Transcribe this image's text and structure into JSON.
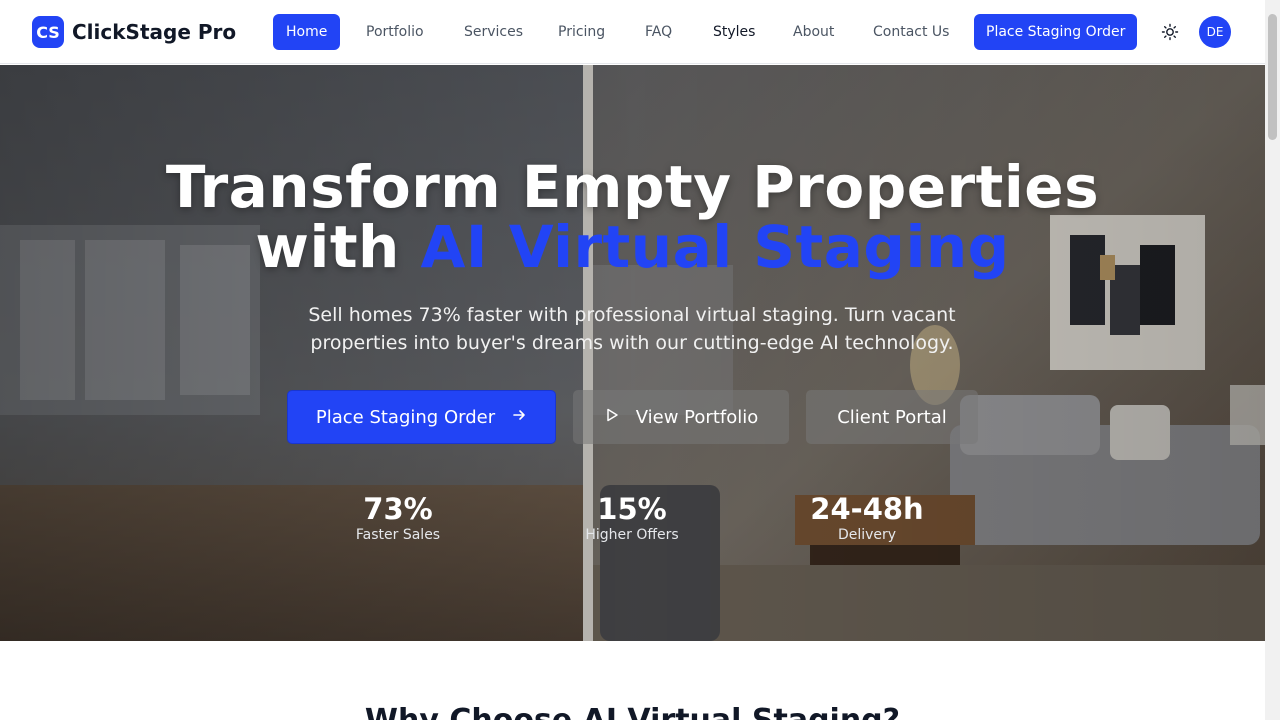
{
  "brand": {
    "logo_text": "CS",
    "name": "ClickStage Pro"
  },
  "nav": {
    "items": [
      {
        "label": "Home",
        "active": true
      },
      {
        "label": "Portfolio"
      },
      {
        "label": "Services"
      },
      {
        "label": "Pricing"
      },
      {
        "label": "FAQ"
      },
      {
        "label": "Styles"
      },
      {
        "label": "About"
      },
      {
        "label": "Contact Us"
      }
    ],
    "cta_label": "Place Staging Order",
    "theme_icon": "sun-icon",
    "avatar_initials": "DE"
  },
  "hero": {
    "title_line1": "Transform Empty Properties",
    "title_line2_prefix": "with",
    "title_line2_accent": "AI Virtual Staging",
    "subtitle": "Sell homes 73% faster with professional virtual staging. Turn vacant properties into buyer's dreams with our cutting-edge AI technology.",
    "buttons": {
      "primary": "Place Staging Order",
      "secondary": "View Portfolio",
      "tertiary": "Client Portal"
    },
    "stats": [
      {
        "value": "73%",
        "label": "Faster Sales"
      },
      {
        "value": "15%",
        "label": "Higher Offers"
      },
      {
        "value": "24-48h",
        "label": "Delivery"
      }
    ]
  },
  "next_section": {
    "title": "Why Choose AI Virtual Staging?"
  },
  "colors": {
    "accent": "#2244f5",
    "text_dark": "#111827",
    "text_muted": "#4b5563"
  }
}
